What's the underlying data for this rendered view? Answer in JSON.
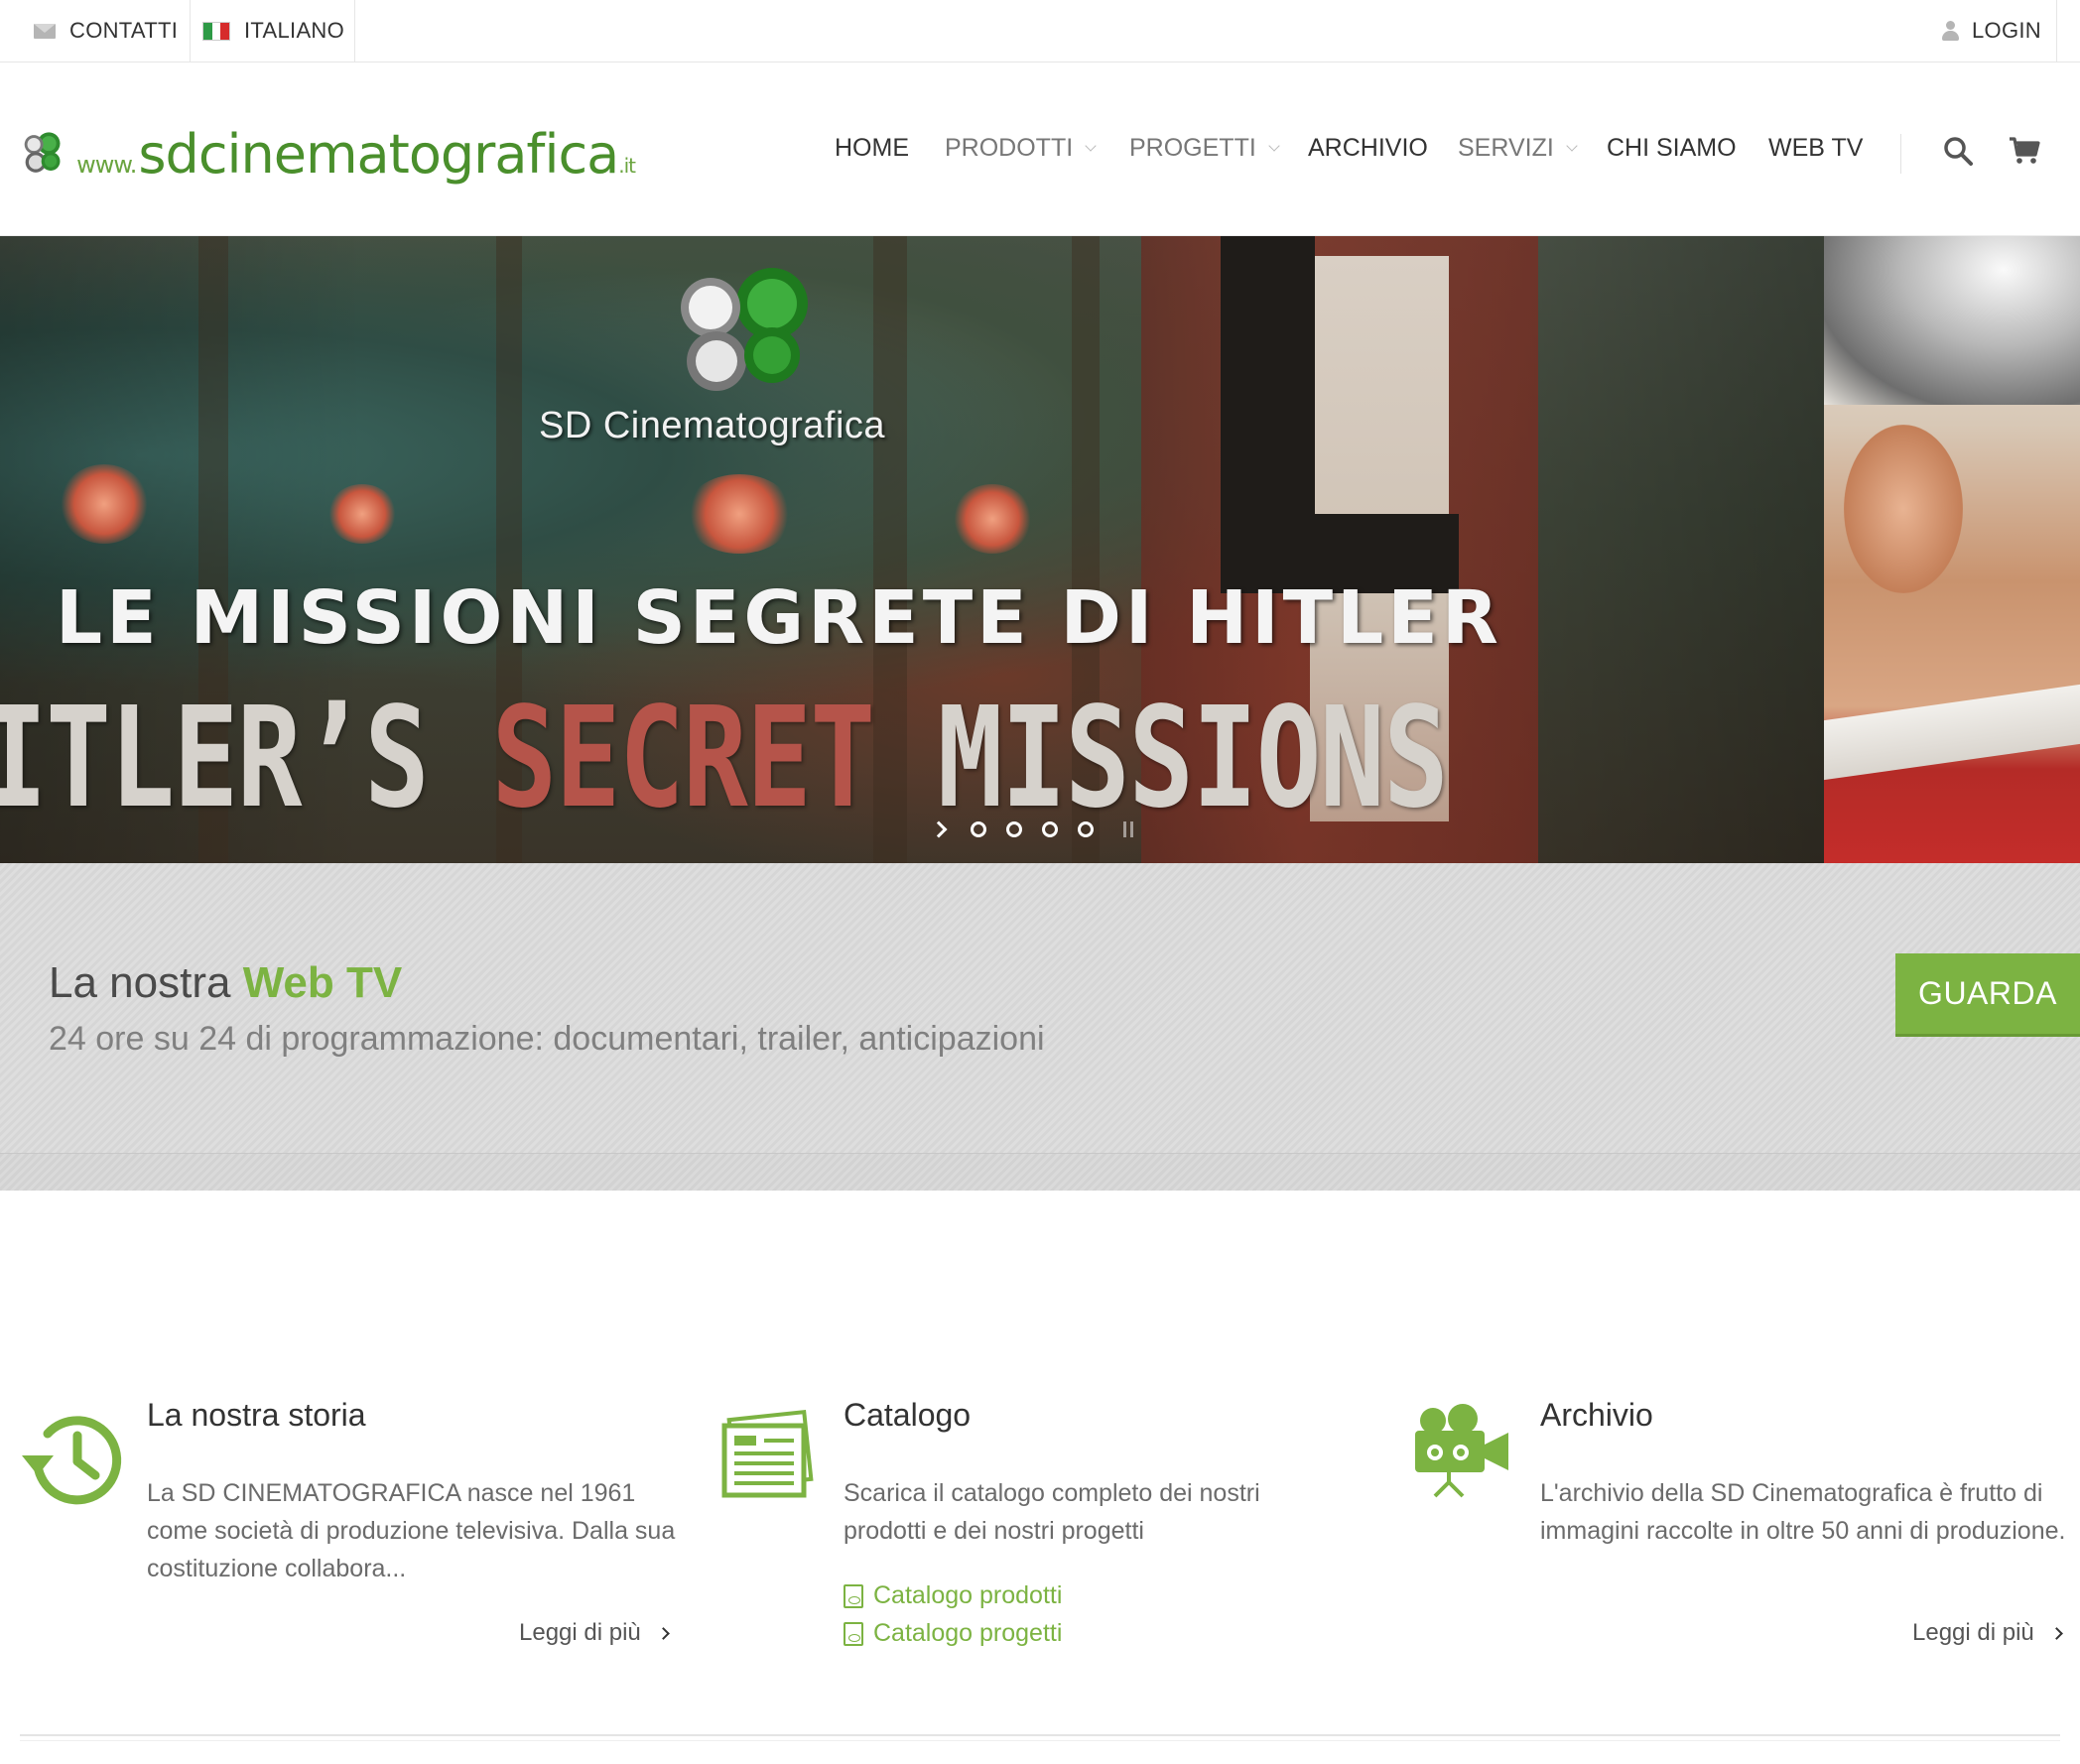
{
  "topbar": {
    "contacts": "CONTATTI",
    "language": "ITALIANO",
    "login": "LOGIN"
  },
  "header": {
    "logo": {
      "www": "www.",
      "name": "sdcinematografica",
      "tld": ".it"
    },
    "nav": [
      {
        "label": "HOME",
        "dropdown": false
      },
      {
        "label": "PRODOTTI",
        "dropdown": true
      },
      {
        "label": "PROGETTI",
        "dropdown": true
      },
      {
        "label": "ARCHIVIO",
        "dropdown": false
      },
      {
        "label": "SERVIZI",
        "dropdown": true
      },
      {
        "label": "CHI SIAMO",
        "dropdown": false
      },
      {
        "label": "WEB TV",
        "dropdown": false
      }
    ]
  },
  "slider": {
    "brand": "SD Cinematografica",
    "title_it": "LE MISSIONI SEGRETE DI HITLER",
    "title_en_part1": "ITLER’S ",
    "title_en_part2": "SECRET",
    "title_en_part3": " MISSIONS",
    "dots": 4
  },
  "webtv": {
    "title_prefix": "La nostra ",
    "title_highlight": "Web TV",
    "subtitle": "24 ore su 24 di programmazione: documentari, trailer, anticipazioni",
    "button": "GUARDA"
  },
  "features": {
    "storia": {
      "title": "La nostra storia",
      "text": "La SD CINEMATOGRAFICA nasce nel 1961 come società di produzione televisiva. Dalla sua costituzione collabora...",
      "more": "Leggi di più"
    },
    "catalogo": {
      "title": "Catalogo",
      "text": "Scarica il catalogo completo dei nostri prodotti e dei nostri progetti",
      "link1": "Catalogo prodotti",
      "link2": "Catalogo progetti"
    },
    "archivio": {
      "title": "Archivio",
      "text": "L'archivio della SD Cinematografica è frutto di immagini raccolte in oltre 50 anni di produzione.",
      "more": "Leggi di più"
    }
  },
  "colors": {
    "accent": "#7cb342",
    "brand_green": "#4a8f2c",
    "text": "#333333",
    "muted": "#6b6b6b"
  },
  "icons": [
    "mail-icon",
    "italy-flag-icon",
    "user-icon",
    "search-icon",
    "cart-icon",
    "history-icon",
    "newspaper-icon",
    "video-camera-icon",
    "pdf-icon",
    "chevron-right-icon"
  ]
}
